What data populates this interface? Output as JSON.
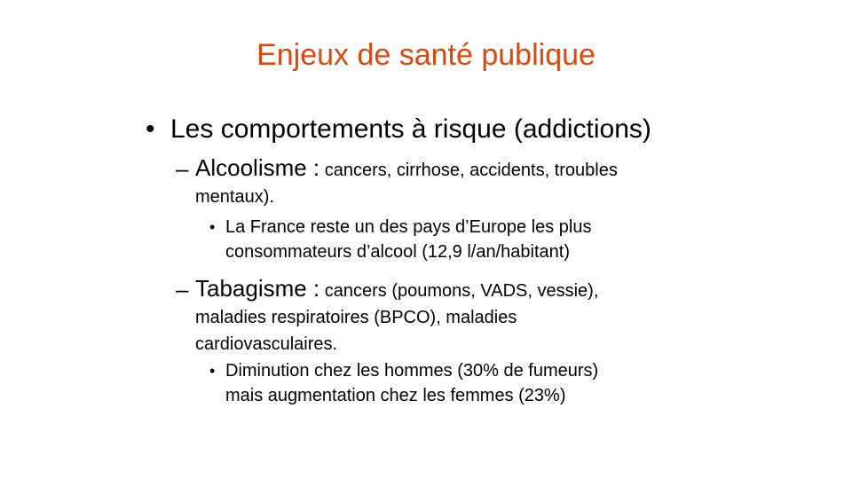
{
  "slide": {
    "title": "Enjeux de santé publique",
    "title_color": "#D9480F",
    "level1": {
      "bullet": "•",
      "text": "Les comportements à risque (addictions)"
    },
    "items": [
      {
        "dash": "–",
        "lead": "Alcoolisme :",
        "rest_line1": " cancers, cirrhose, accidents, troubles",
        "rest_line2": "mentaux).",
        "sub": {
          "bullet": "•",
          "line1": "La France reste un des pays d’Europe les plus",
          "line2": "consommateurs d’alcool (12,9 l/an/habitant)"
        }
      },
      {
        "dash": "–",
        "lead": "Tabagisme :",
        "rest_line1": " cancers (poumons, VADS, vessie),",
        "rest_line2": "maladies respiratoires (BPCO), maladies",
        "rest_line3": "cardiovasculaires.",
        "sub": {
          "bullet": "•",
          "line1": "Diminution chez les hommes (30% de fumeurs)",
          "line2": "mais augmentation chez les femmes (23%)"
        }
      }
    ]
  }
}
